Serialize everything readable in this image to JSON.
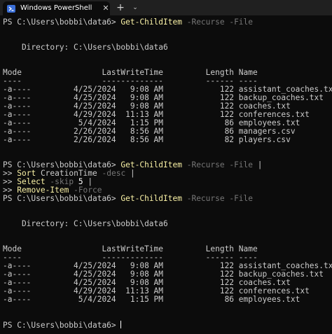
{
  "window": {
    "tab_title": "Windows PowerShell",
    "close_glyph": "✕",
    "new_tab_glyph": "+",
    "dropdown_glyph": "⌄"
  },
  "terminal": {
    "prompt": "PS C:\\Users\\bobbi\\data6>",
    "cmd1": {
      "cmdlet": "Get-ChildItem",
      "params": "-Recurse -File"
    },
    "directory_line": "    Directory: C:\\Users\\bobbi\\data6",
    "header": "Mode                 LastWriteTime         Length Name",
    "separator": "----                 -------------         ------ ----",
    "listing1": [
      "-a----         4/25/2024   9:08 AM            122 assistant_coaches.txt",
      "-a----         4/25/2024   9:08 AM            122 backup_coaches.txt",
      "-a----         4/25/2024   9:08 AM            122 coaches.txt",
      "-a----         4/29/2024  11:13 AM            122 conferences.txt",
      "-a----          5/4/2024   1:15 PM             86 employees.txt",
      "-a----         2/26/2024   8:56 AM             86 managers.csv",
      "-a----         2/26/2024   8:56 AM             82 players.csv"
    ],
    "pipeline": {
      "line1_cmdlet": "Get-ChildItem",
      "line1_params": "-Recurse -File",
      "line1_pipe": "|",
      "continuation": ">>",
      "line2_cmdlet": "Sort",
      "line2_arg": "CreationTime",
      "line2_param": "-desc",
      "line2_pipe": "|",
      "line3_cmdlet": "Select",
      "line3_param": "-skip",
      "line3_num": "5",
      "line3_pipe": "|",
      "line4_cmdlet": "Remove-Item",
      "line4_param": "-Force"
    },
    "cmd2": {
      "cmdlet": "Get-ChildItem",
      "params": "-Recurse -File"
    },
    "listing2": [
      "-a----         4/25/2024   9:08 AM            122 assistant_coaches.txt",
      "-a----         4/25/2024   9:08 AM            122 backup_coaches.txt",
      "-a----         4/25/2024   9:08 AM            122 coaches.txt",
      "-a----         4/29/2024  11:13 AM            122 conferences.txt",
      "-a----          5/4/2024   1:15 PM             86 employees.txt"
    ]
  },
  "colors": {
    "background": "#0c0c0c",
    "foreground": "#cccccc",
    "cmdlet": "#f9f1a5",
    "parameter": "#767676",
    "titlebar": "#202020"
  }
}
